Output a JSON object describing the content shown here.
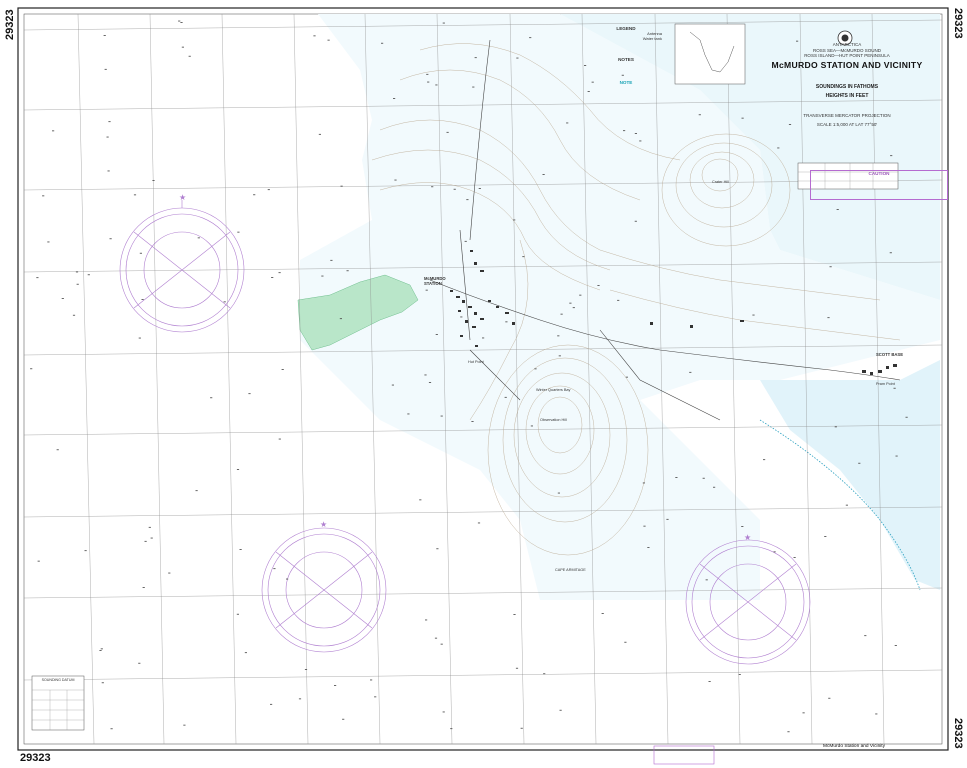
{
  "chart_number": "29323",
  "title": {
    "region": "ANTARCTICA",
    "subregion": "ROSS SEA—McMURDO SOUND",
    "area": "ROSS ISLAND—HUT POINT PENINSULA",
    "main": "McMURDO STATION AND VICINITY",
    "soundings": "SOUNDINGS IN FATHOMS",
    "heights": "HEIGHTS IN FEET",
    "projection": "TRANSVERSE MERCATOR PROJECTION",
    "scale": "SCALE 1:5,000 AT LAT 77°50'"
  },
  "legend": {
    "heading": "LEGEND",
    "items": [
      "Antenna",
      "Water tank"
    ],
    "notes_heading": "NOTES",
    "note_heading": "NOTE"
  },
  "caution": {
    "heading": "CAUTION"
  },
  "places": {
    "station": "McMURDO STATION",
    "scott_base": "SCOTT BASE",
    "observation_hill": "Observation Hill",
    "pram_point": "Pram Point",
    "cape_armitage": "CAPE ARMITAGE",
    "hut_point": "Hut Point",
    "crater_hill": "Crater Hill",
    "winter_quarters": "Winter Quarters Bay"
  },
  "bottom": {
    "chart_title_small": "McMurdo Station and Vicinity",
    "edition_box": "SOUNDING DATUM"
  },
  "colors": {
    "water": "#e6f6fb",
    "shoal": "#cdeaf2",
    "green": "#b9e6c9",
    "compass": "#b07fd0",
    "contour": "#b8a48c",
    "grid": "#8a8a8a"
  }
}
